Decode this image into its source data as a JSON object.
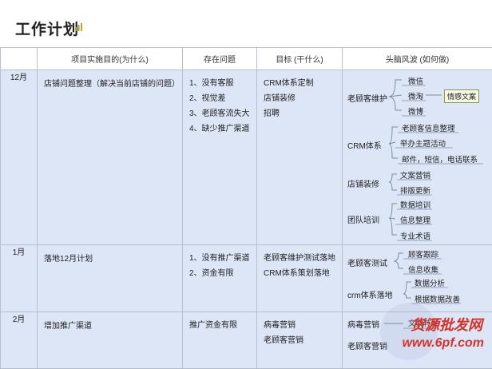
{
  "header": {
    "title": "工作计划"
  },
  "columns": [
    "",
    "项目实施目的(为什么)",
    "存在问题",
    "目标 (干什么)",
    "头脑风波 (如何做)"
  ],
  "rows": [
    {
      "month": "12月",
      "purpose": "店铺问题整理（解决当前店铺的问题）",
      "problems": [
        "1、没有客服",
        "2、视觉差",
        "3、老顾客流失大",
        "4、缺少推广渠道"
      ],
      "goals": [
        "CRM体系定制",
        "店铺装修",
        "招聘"
      ],
      "brainstorm": {
        "groups": [
          {
            "name": "老顾客维护",
            "items": [
              "微信",
              "微淘",
              "微博"
            ],
            "tag": "情感文案"
          },
          {
            "name": "CRM体系",
            "items": [
              "老顾客信息整理",
              "举办主题活动",
              "邮件，短信，电话联系"
            ]
          },
          {
            "name": "店铺装修",
            "items": [
              "文案营销",
              "排版更新"
            ]
          },
          {
            "name": "团队培训",
            "items": [
              "数据培训",
              "信息整理",
              "专业术语"
            ]
          }
        ]
      }
    },
    {
      "month": "1月",
      "purpose": "落地12月计划",
      "problems": [
        "1、没有推广渠道",
        "2、资金有限"
      ],
      "goals": [
        "老顾客维护测试落地",
        "CRM体系策划落地"
      ],
      "brainstorm": {
        "groups": [
          {
            "name": "老顾客测试",
            "items": [
              "顾客跟踪",
              "信息收集"
            ]
          },
          {
            "name": "crm体系落地",
            "items": [
              "数据分析",
              "根据数据改善"
            ]
          }
        ]
      }
    },
    {
      "month": "2月",
      "purpose": "增加推广渠道",
      "problems": [
        "推广资金有限"
      ],
      "goals": [
        "病毒营销",
        "老顾客营销"
      ],
      "brainstorm": {
        "groups": [
          {
            "name": "病毒营销",
            "items": [
              "文案转发"
            ]
          },
          {
            "name": "老顾客营销",
            "items": []
          }
        ]
      }
    }
  ],
  "watermark": {
    "line1": "货源批发网",
    "line2": "www.6pf.com"
  }
}
